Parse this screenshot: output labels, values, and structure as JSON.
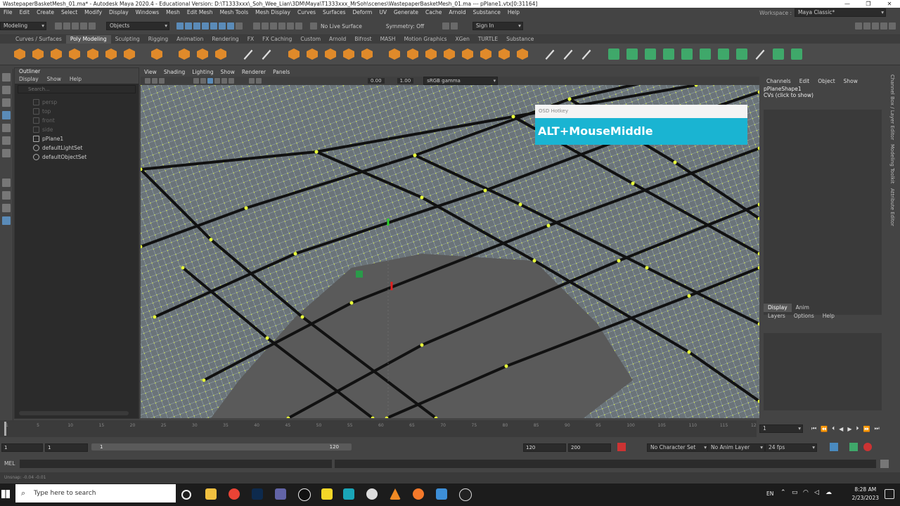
{
  "window": {
    "title": "WastepaperBasketMesh_01.ma* - Autodesk Maya 2020.4 - Educational Version: D:\\T1333xxx\\_Soh_Wee_Lian\\3DM\\Maya\\T1333xxx_MrSoh\\scenes\\WastepaperBasketMesh_01.ma   ---   pPlane1.vtx[0:31164]",
    "minimize": "—",
    "maximize": "❐",
    "close": "✕"
  },
  "menubar": {
    "items": [
      "File",
      "Edit",
      "Create",
      "Select",
      "Modify",
      "Display",
      "Windows",
      "Mesh",
      "Edit Mesh",
      "Mesh Tools",
      "Mesh Display",
      "Curves",
      "Surfaces",
      "Deform",
      "UV",
      "Generate",
      "Cache",
      "Arnold",
      "Substance",
      "Help"
    ],
    "workspace_label": "Workspace :",
    "workspace_value": "Maya Classic*"
  },
  "statusline": {
    "mode": "Modeling",
    "objects": "Objects",
    "live_surface": "No Live Surface",
    "symmetry": "Symmetry: Off",
    "sign_in": "Sign In"
  },
  "shelf_tabs": {
    "items": [
      "Curves / Surfaces",
      "Poly Modeling",
      "Sculpting",
      "Rigging",
      "Animation",
      "Rendering",
      "FX",
      "FX Caching",
      "Custom",
      "Arnold",
      "Bifrost",
      "MASH",
      "Motion Graphics",
      "XGen",
      "TURTLE",
      "Substance"
    ],
    "active_index": 1
  },
  "outliner": {
    "title": "Outliner",
    "menu": [
      "Display",
      "Show",
      "Help"
    ],
    "search_placeholder": "Search...",
    "items": [
      {
        "label": "persp",
        "dim": true
      },
      {
        "label": "top",
        "dim": true
      },
      {
        "label": "front",
        "dim": true
      },
      {
        "label": "side",
        "dim": true
      },
      {
        "label": "pPlane1",
        "dim": false
      },
      {
        "label": "defaultLightSet",
        "dim": false
      },
      {
        "label": "defaultObjectSet",
        "dim": false
      }
    ]
  },
  "viewport": {
    "menu": [
      "View",
      "Shading",
      "Lighting",
      "Show",
      "Renderer",
      "Panels"
    ],
    "exposure": "0.00",
    "gamma": "1.00",
    "color_space": "sRGB gamma",
    "colors": {
      "mesh_bg": "#5a5a5a",
      "vertex": "#e8ff3a",
      "wire": "#1b1b1b",
      "wire_light": "#9fb0b8"
    }
  },
  "osd": {
    "title": "OSD Hotkey",
    "text": "ALT+MouseMiddle",
    "color": "#1ab4d2"
  },
  "channel_box": {
    "menu": [
      "Channels",
      "Edit",
      "Object",
      "Show"
    ],
    "shape": "pPlaneShape1",
    "cvs": "CVs (click to show)"
  },
  "layer_editor": {
    "tabs": [
      "Display",
      "Anim"
    ],
    "active_index": 0,
    "menu": [
      "Layers",
      "Options",
      "Help"
    ]
  },
  "side_tabs": [
    "Channel Box / Layer Editor",
    "Modeling Toolkit",
    "Attribute Editor"
  ],
  "timeline": {
    "ticks": [
      "1",
      "5",
      "10",
      "15",
      "20",
      "25",
      "30",
      "35",
      "40",
      "45",
      "50",
      "55",
      "60",
      "65",
      "70",
      "75",
      "80",
      "85",
      "90",
      "95",
      "100",
      "105",
      "110",
      "115",
      "120"
    ],
    "current_frame": "1"
  },
  "range": {
    "start": "1",
    "start_inner": "1",
    "slider_start": "1",
    "slider_end": "120",
    "end_inner": "120",
    "end": "200",
    "character_set": "No Character Set",
    "anim_layer": "No Anim Layer",
    "fps": "24 fps"
  },
  "command_line": {
    "label": "MEL"
  },
  "help_line": {
    "text": "Unsnap: -0.04      -0.01"
  },
  "taskbar": {
    "search_placeholder": "Type here to search",
    "lang": "EN",
    "time": "8:28 AM",
    "date": "2/23/2023"
  }
}
